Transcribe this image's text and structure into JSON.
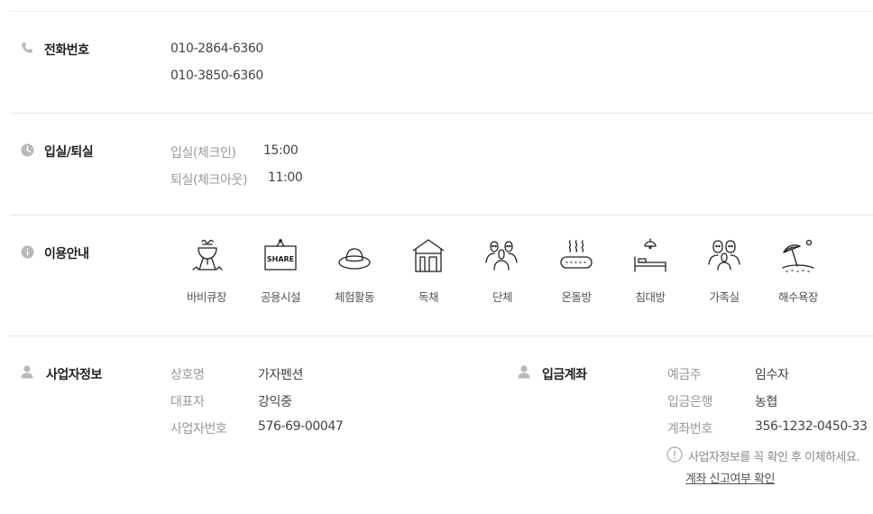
{
  "phone": {
    "title": "전화번호",
    "icon": "phone-icon",
    "numbers": [
      "010-2864-6360",
      "010-3850-6360"
    ]
  },
  "checkin": {
    "title": "입실/퇴실",
    "icon": "clock-icon",
    "checkin_label": "입실(체크인)",
    "checkin_time": "15:00",
    "checkout_label": "퇴실(체크아웃)",
    "checkout_time": "11:00"
  },
  "usage": {
    "title": "이용안내",
    "icon": "info-icon",
    "amenities": [
      {
        "label": "바비큐장",
        "icon": "bbq-grill-icon"
      },
      {
        "label": "공용시설",
        "icon": "share-sign-icon"
      },
      {
        "label": "체험활동",
        "icon": "hat-icon"
      },
      {
        "label": "독채",
        "icon": "house-icon"
      },
      {
        "label": "단체",
        "icon": "group-icon"
      },
      {
        "label": "온돌방",
        "icon": "heated-floor-icon"
      },
      {
        "label": "침대방",
        "icon": "bed-icon"
      },
      {
        "label": "가족실",
        "icon": "family-icon"
      },
      {
        "label": "해수욕장",
        "icon": "beach-umbrella-icon"
      }
    ]
  },
  "business": {
    "title": "사업자정보",
    "icon": "person-icon",
    "rows": [
      {
        "label": "상호명",
        "value": "가자펜션"
      },
      {
        "label": "대표자",
        "value": "강익중"
      },
      {
        "label": "사업자번호",
        "value": "576-69-00047"
      }
    ]
  },
  "account": {
    "title": "입금계좌",
    "icon": "person-icon",
    "rows": [
      {
        "label": "예금주",
        "value": "임수자"
      },
      {
        "label": "입금은행",
        "value": "농협"
      },
      {
        "label": "계좌번호",
        "value": "356-1232-0450-33"
      }
    ],
    "notice": "사업자정보를 꼭 확인 후 이체하세요.",
    "notice_icon": "exclamation-circle-icon",
    "link": "계좌 신고여부 확인"
  }
}
